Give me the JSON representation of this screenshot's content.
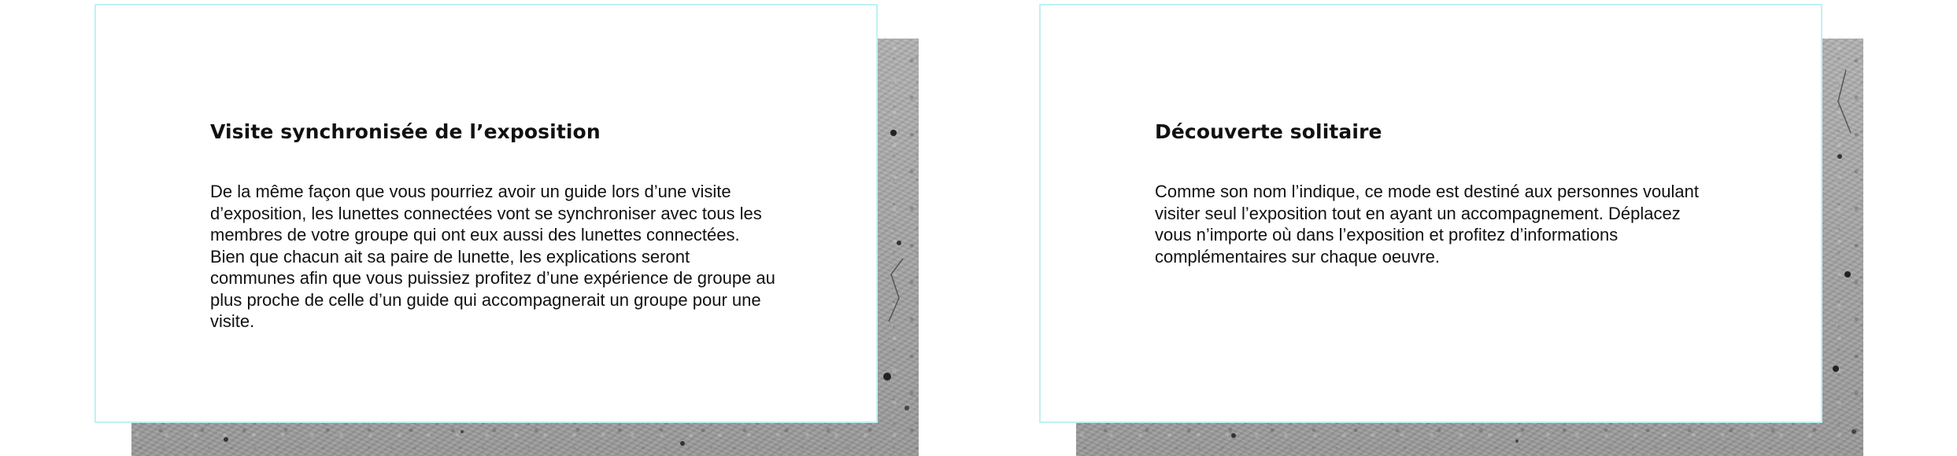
{
  "cards": [
    {
      "title": "Visite synchronisée de l’exposition",
      "body": "De la même façon que vous pourriez avoir un guide lors d’une visite d’exposition, les lunettes connectées vont se synchroniser avec tous les membres de votre groupe qui ont eux aussi des lunettes connectées. Bien que chacun ait sa paire de lunette, les explications seront communes afin que vous puissiez profitez d’une expérience de groupe au plus proche de celle d’un guide qui accompagnerait un groupe pour une visite."
    },
    {
      "title": "Découverte solitaire",
      "body": "Comme son nom l’indique, ce mode est destiné aux personnes voulant visiter seul l’exposition tout en ayant un accompagnement. Déplacez vous n’importe où dans l’exposition et profitez d’informations complémentaires sur chaque oeuvre."
    }
  ],
  "colors": {
    "card_border": "#bff1f4",
    "text": "#111111",
    "concrete": "#a9a9a9"
  }
}
